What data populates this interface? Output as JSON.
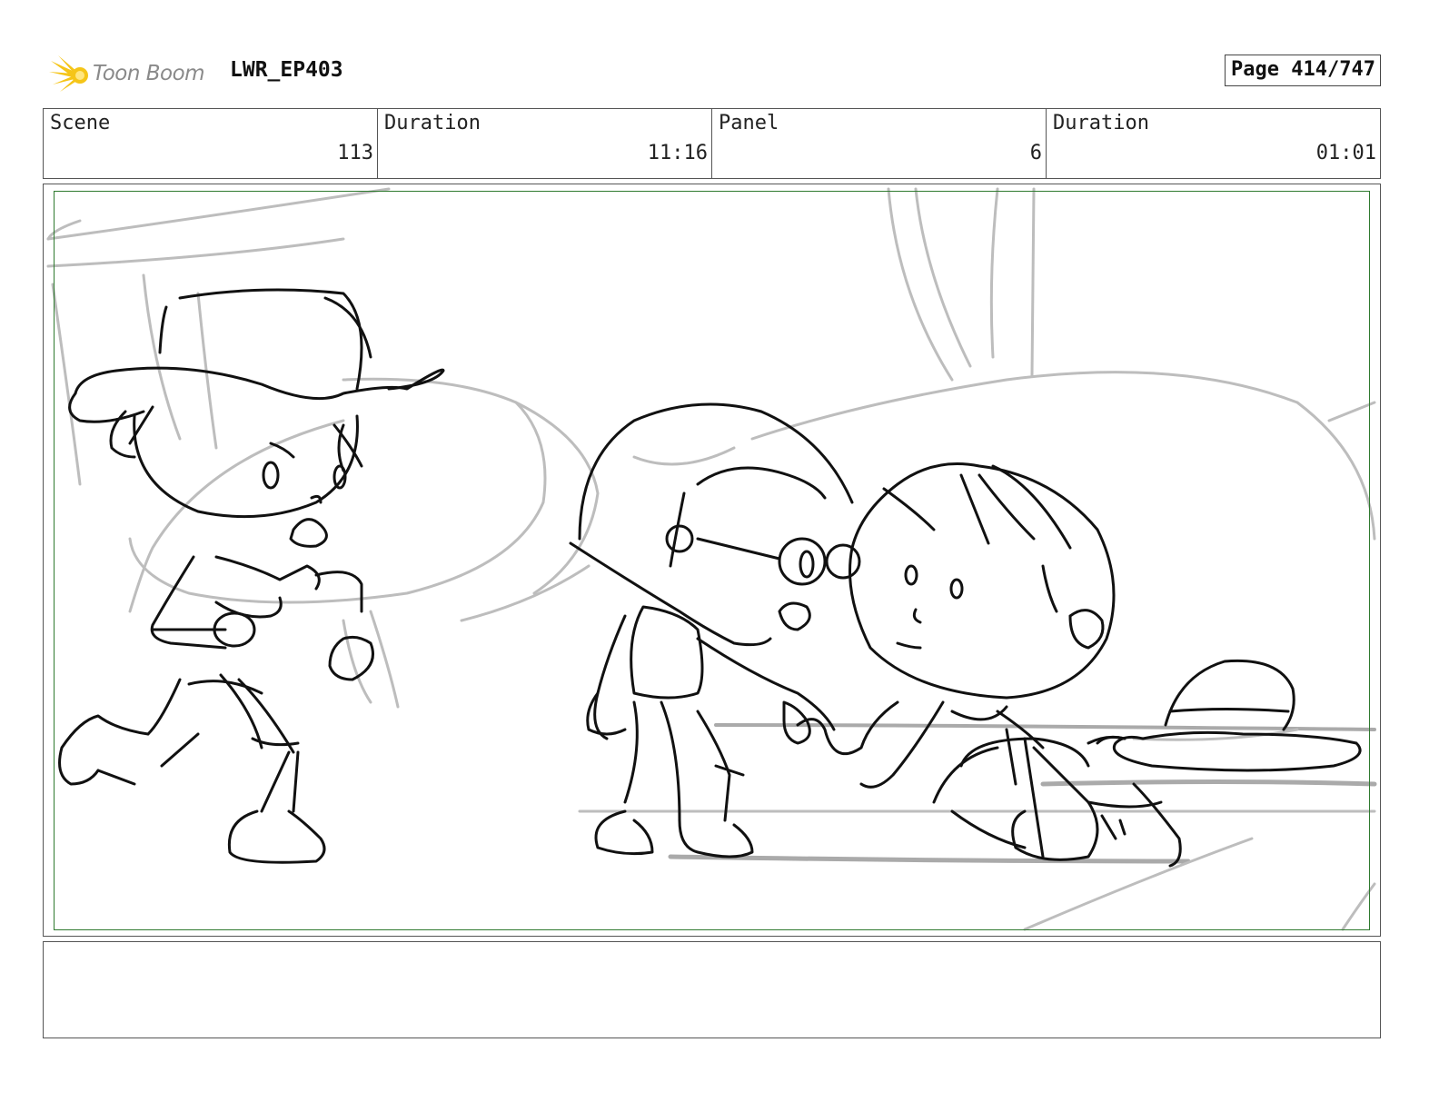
{
  "header": {
    "logo_text": "Toon Boom",
    "project": "LWR_EP403",
    "page_label": "Page 414/747"
  },
  "info": [
    {
      "label": "Scene",
      "value": "113"
    },
    {
      "label": "Duration",
      "value": "11:16"
    },
    {
      "label": "Panel",
      "value": "6"
    },
    {
      "label": "Duration",
      "value": "01:01"
    }
  ],
  "notes": {
    "text": ""
  },
  "colors": {
    "logo_accent": "#f5c518",
    "safe_frame": "#2f7a2f",
    "background_sketch": "#bdbdbd",
    "line_art": "#111111"
  }
}
